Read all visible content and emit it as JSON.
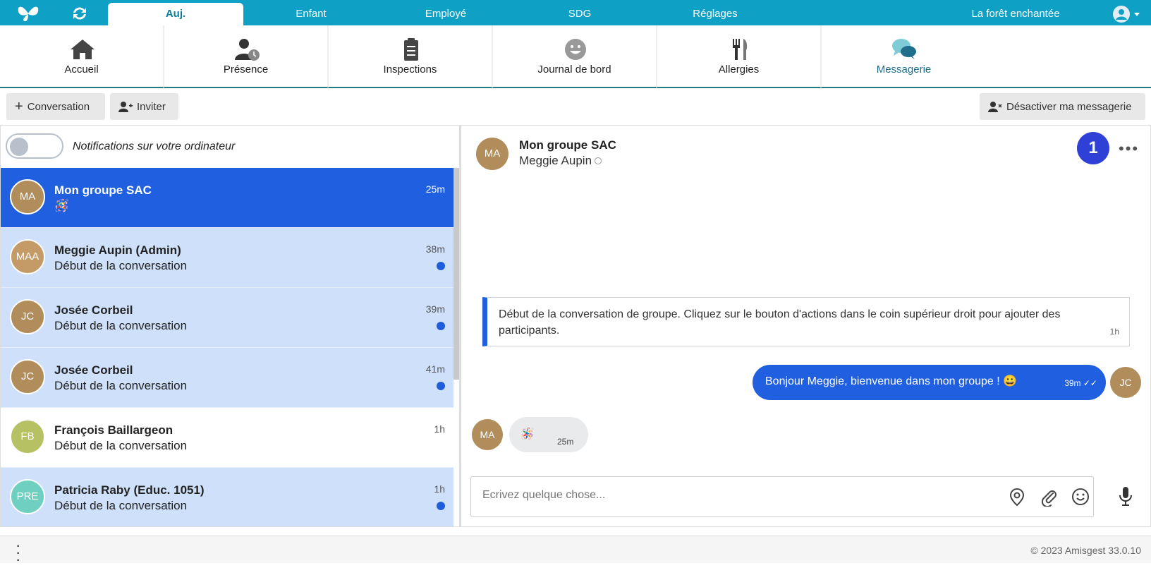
{
  "topnav": {
    "tabs": [
      {
        "label": "Auj.",
        "active": true
      },
      {
        "label": "Enfant"
      },
      {
        "label": "Employé"
      },
      {
        "label": "SDG"
      },
      {
        "label": "Réglages"
      }
    ],
    "center_name": "La forêt enchantée"
  },
  "modules": [
    {
      "label": "Accueil",
      "icon": "home-icon"
    },
    {
      "label": "Présence",
      "icon": "user-clock-icon"
    },
    {
      "label": "Inspections",
      "icon": "clipboard-icon"
    },
    {
      "label": "Journal de bord",
      "icon": "smile-icon"
    },
    {
      "label": "Allergies",
      "icon": "fork-knife-icon"
    },
    {
      "label": "Messagerie",
      "icon": "chat-bubbles-icon",
      "active": true
    }
  ],
  "toolbar": {
    "conversation_label": "Conversation",
    "invite_label": "Inviter",
    "disable_label": "Désactiver ma messagerie"
  },
  "notifications": {
    "label": "Notifications sur votre ordinateur",
    "enabled": false
  },
  "conversations": [
    {
      "initials": "MA",
      "name": "Mon groupe SAC",
      "preview": "🪅",
      "time": "25m",
      "color": "#b08d5a",
      "selected": true,
      "unread": false
    },
    {
      "initials": "MAA",
      "name": "Meggie Aupin (Admin)",
      "preview": "Début de la conversation",
      "time": "38m",
      "color": "#c49a66",
      "unread": true
    },
    {
      "initials": "JC",
      "name": "Josée Corbeil",
      "preview": "Début de la conversation",
      "time": "39m",
      "color": "#b08d5a",
      "unread": true
    },
    {
      "initials": "JC",
      "name": "Josée Corbeil",
      "preview": "Début de la conversation",
      "time": "41m",
      "color": "#b08d5a",
      "unread": true
    },
    {
      "initials": "FB",
      "name": "François Baillargeon",
      "preview": "Début de la conversation",
      "time": "1h",
      "color": "#b6c163",
      "unread": false
    },
    {
      "initials": "PRE",
      "name": "Patricia Raby (Educ. 1051)",
      "preview": "Début de la conversation",
      "time": "1h",
      "color": "#6fcfc0",
      "unread": true
    }
  ],
  "chat": {
    "header_initials": "MA",
    "title": "Mon groupe SAC",
    "subtitle": "Meggie Aupin",
    "badge": "1",
    "system_message": "Début de la conversation de groupe. Cliquez sur le bouton d'actions dans le coin supérieur droit pour ajouter des participants.",
    "system_time": "1h",
    "outgoing": {
      "text": "Bonjour Meggie, bienvenue dans mon groupe ! 😀",
      "time": "39m ✓✓",
      "initials": "JC"
    },
    "incoming": {
      "text": "🪅",
      "time": "25m",
      "initials": "MA"
    },
    "composer_placeholder": "Ecrivez quelque chose..."
  },
  "footer": {
    "copyright": "© 2023 Amisgest 33.0.10"
  },
  "colors": {
    "topbar": "#0fa0c6",
    "accent": "#1f5fe0",
    "badge": "#2f40d6"
  }
}
